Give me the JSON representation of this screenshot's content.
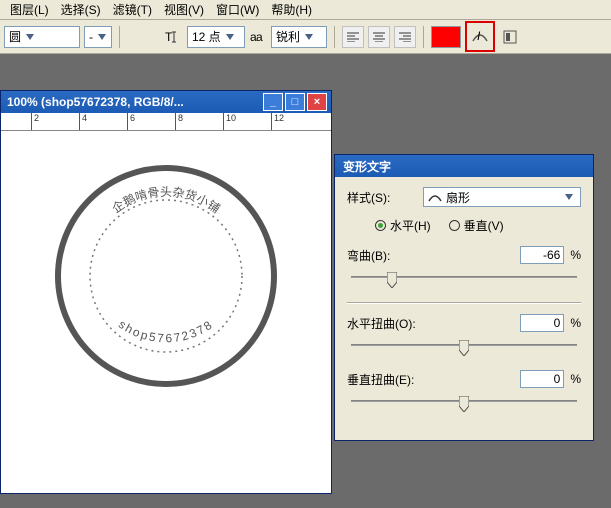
{
  "menu": {
    "items": [
      "图层(L)",
      "选择(S)",
      "滤镜(T)",
      "视图(V)",
      "窗口(W)",
      "帮助(H)"
    ]
  },
  "toolbar": {
    "shape": "圆",
    "fontsize": "12 点",
    "aa": "锐利"
  },
  "doc": {
    "title": "100% (shop57672378, RGB/8/...",
    "ruler_ticks": [
      "2",
      "4",
      "6",
      "8",
      "10",
      "12"
    ],
    "stamp_upper": "企鹅啃骨头杂货小铺",
    "stamp_lower": "shop57672378"
  },
  "panel": {
    "title": "变形文字",
    "style_label": "样式(S):",
    "style_value": "扇形",
    "radio_h": "水平(H)",
    "radio_v": "垂直(V)",
    "bend_label": "弯曲(B):",
    "bend_value": "-66",
    "hdist_label": "水平扭曲(O):",
    "hdist_value": "0",
    "vdist_label": "垂直扭曲(E):",
    "vdist_value": "0",
    "pct": "%"
  }
}
